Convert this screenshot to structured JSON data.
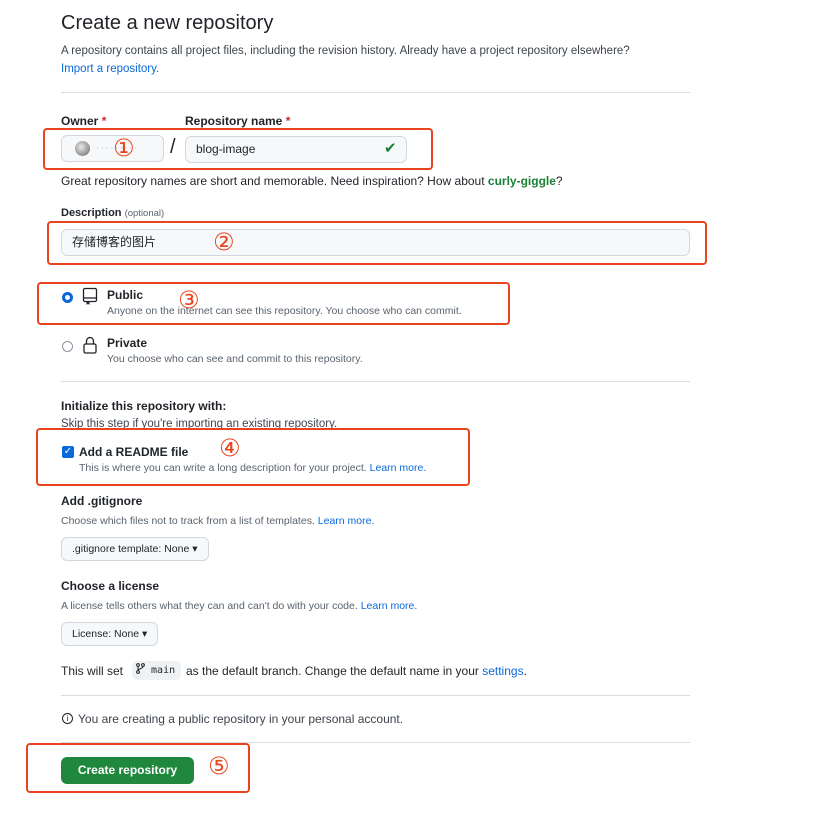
{
  "header": {
    "title": "Create a new repository",
    "intro_text": "A repository contains all project files, including the revision history. Already have a project repository elsewhere?",
    "import_link": "Import a repository."
  },
  "owner": {
    "label": "Owner",
    "required_mark": "*",
    "name_obscured": "·········"
  },
  "repo": {
    "label": "Repository name",
    "required_mark": "*",
    "slash": "/",
    "value": "blog-image",
    "hint_prefix": "Great repository names are short and memorable. Need inspiration? How about",
    "suggestion": "curly-giggle",
    "hint_suffix": "?"
  },
  "description": {
    "label": "Description",
    "optional": "(optional)",
    "value": "存储博客的图片"
  },
  "visibility": {
    "public": {
      "label": "Public",
      "desc": "Anyone on the internet can see this repository. You choose who can commit.",
      "selected": true
    },
    "private": {
      "label": "Private",
      "desc": "You choose who can see and commit to this repository.",
      "selected": false
    }
  },
  "init": {
    "heading": "Initialize this repository with:",
    "skip_text": "Skip this step if you're importing an existing repository.",
    "readme": {
      "label": "Add a README file",
      "desc": "This is where you can write a long description for your project.",
      "learn_more": "Learn more.",
      "checked": true
    }
  },
  "gitignore": {
    "heading": "Add .gitignore",
    "desc": "Choose which files not to track from a list of templates.",
    "learn_more": "Learn more.",
    "button": ".gitignore template: None ▾"
  },
  "license": {
    "heading": "Choose a license",
    "desc": "A license tells others what they can and can't do with your code.",
    "learn_more": "Learn more.",
    "button": "License: None ▾"
  },
  "branch": {
    "prefix": "This will set",
    "branch_name": "main",
    "middle": "as the default branch. Change the default name in your",
    "settings_link": "settings",
    "suffix": "."
  },
  "notice": "You are creating a public repository in your personal account.",
  "submit": {
    "label": "Create repository"
  },
  "annotations": {
    "n1": "①",
    "n2": "②",
    "n3": "③",
    "n4": "④",
    "n5": "⑤",
    "color": "#e8451f"
  },
  "colors": {
    "accent": "#0969da",
    "success": "#1f883d",
    "danger": "#d1242f"
  }
}
